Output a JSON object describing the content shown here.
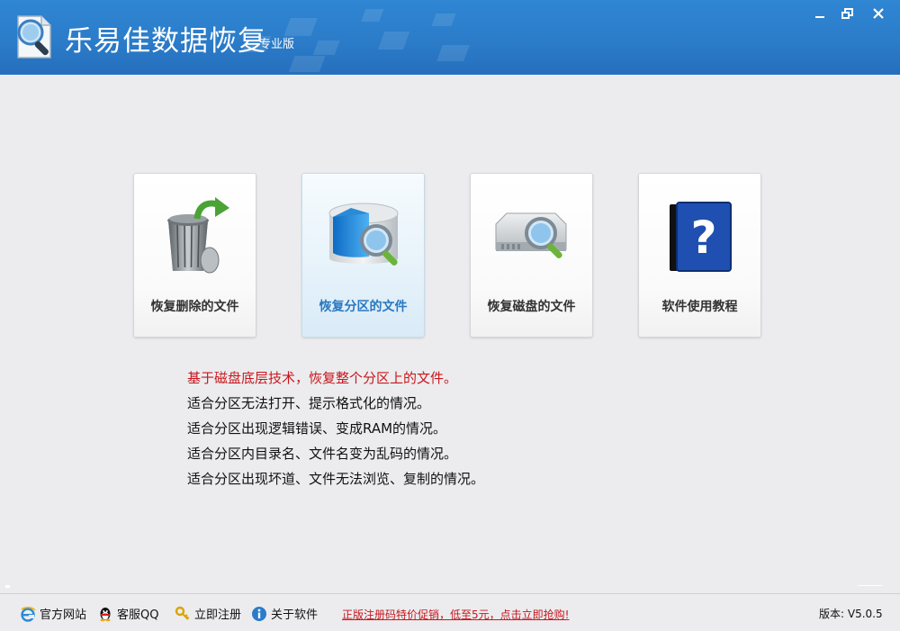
{
  "app": {
    "title": "乐易佳数据恢复",
    "edition": "专业版"
  },
  "window_controls": {
    "minimize": "minimize-icon",
    "restore": "restore-icon",
    "close": "close-icon"
  },
  "features": [
    {
      "label": "恢复删除的文件",
      "icon": "recycle-bin-icon",
      "active": false
    },
    {
      "label": "恢复分区的文件",
      "icon": "partition-search-icon",
      "active": true
    },
    {
      "label": "恢复磁盘的文件",
      "icon": "disk-search-icon",
      "active": false
    },
    {
      "label": "软件使用教程",
      "icon": "help-book-icon",
      "active": false
    }
  ],
  "description": [
    "基于磁盘底层技术，恢复整个分区上的文件。",
    "适合分区无法打开、提示格式化的情况。",
    "适合分区出现逻辑错误、变成RAM的情况。",
    "适合分区内目录名、文件名变为乱码的情况。",
    "适合分区出现坏道、文件无法浏览、复制的情况。"
  ],
  "footer": {
    "website": "官方网站",
    "qq": "客服QQ",
    "register": "立即注册",
    "about": "关于软件",
    "promo": "正版注册码特价促销，低至5元，点击立即抢购!",
    "version": "版本: V5.0.5"
  },
  "colors": {
    "titlebar": "#2b7cc9",
    "accent_text": "#2a78c0",
    "highlight_red": "#c8161d"
  }
}
